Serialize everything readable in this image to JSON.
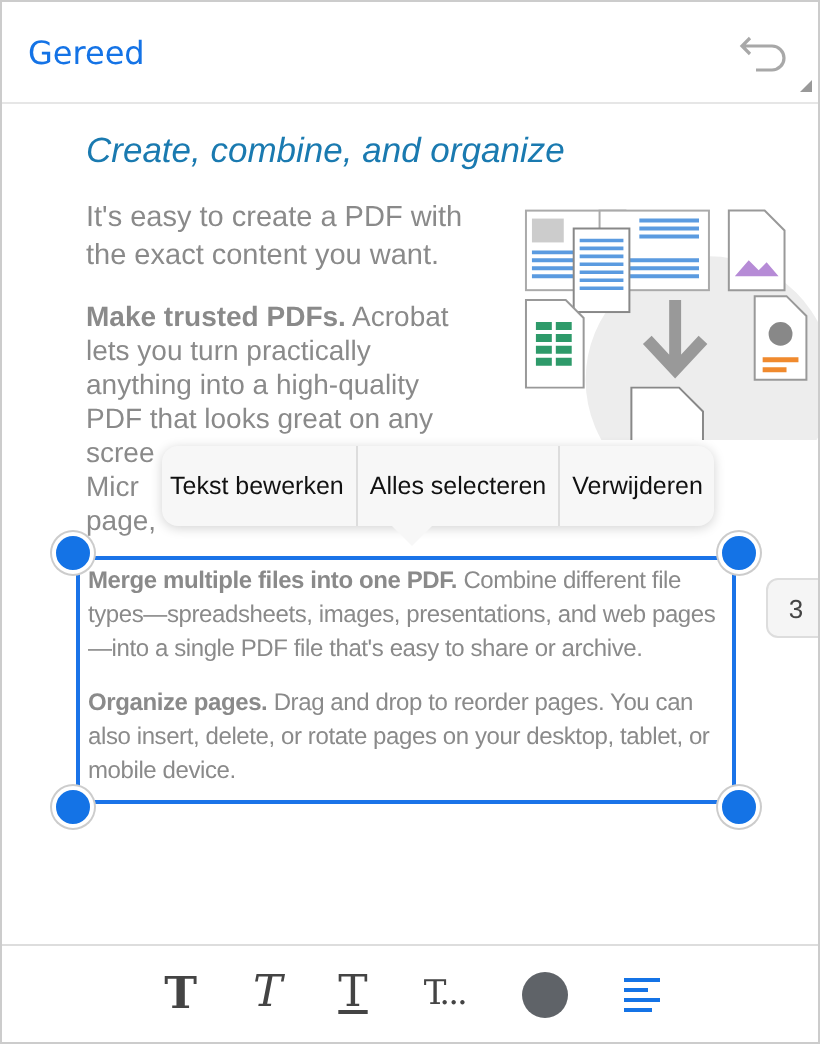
{
  "header": {
    "done_label": "Gereed"
  },
  "document": {
    "title": "Create, combine, and organize",
    "intro": "It's easy to create a PDF with the exact content you want.",
    "lines": [
      "**Make trusted PDFs.** Acrobat",
      "lets you turn practically",
      "anything into a high-quality",
      "PDF that looks great on any"
    ],
    "fragments": [
      "scree",
      "Micr",
      "page,"
    ],
    "selection": {
      "paragraphs": [
        "**Merge multiple files into one PDF.** Combine different file types—spreadsheets, images, presentations, and web pages—into a single PDF file that's easy to share or archive.",
        "**Organize pages.** Drag and drop to reorder pages. You can also insert, delete, or rotate pages on your desktop, tablet, or mobile device."
      ]
    }
  },
  "context_menu": [
    "Tekst bewerken",
    "Alles selecteren",
    "Verwijderen"
  ],
  "page_tab": "3",
  "toolbar": [
    {
      "kind": "bold",
      "glyph": "T",
      "selected": false
    },
    {
      "kind": "italic",
      "glyph": "T",
      "selected": false
    },
    {
      "kind": "underline",
      "glyph": "T",
      "selected": false
    },
    {
      "kind": "more",
      "glyph": "T...",
      "selected": false
    },
    {
      "kind": "color",
      "color": "#5f6368",
      "selected": false
    },
    {
      "kind": "align",
      "selected": true
    }
  ]
}
